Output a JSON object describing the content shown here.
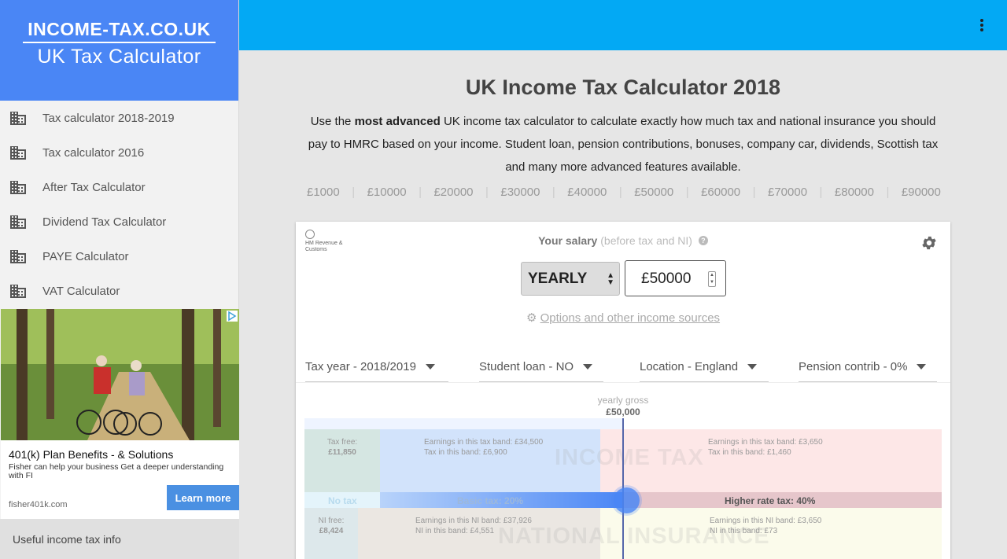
{
  "brand": {
    "site": "INCOME-TAX.CO.UK",
    "subtitle": "UK Tax Calculator"
  },
  "sidebar": {
    "items": [
      {
        "label": "Tax calculator 2018-2019",
        "icon": "building-icon"
      },
      {
        "label": "Tax calculator 2016",
        "icon": "building-icon"
      },
      {
        "label": "After Tax Calculator",
        "icon": "building-icon"
      },
      {
        "label": "Dividend Tax Calculator",
        "icon": "building-icon"
      },
      {
        "label": "PAYE Calculator",
        "icon": "building-icon"
      },
      {
        "label": "VAT Calculator",
        "icon": "building-icon"
      }
    ],
    "footer_link": "Useful income tax info"
  },
  "ad": {
    "title": "401(k) Plan Benefits - & Solutions",
    "description": "Fisher can help your business Get a deeper understanding with FI",
    "domain": "fisher401k.com",
    "cta": "Learn more"
  },
  "main": {
    "title": "UK Income Tax Calculator 2018",
    "intro_pre": "Use the ",
    "intro_bold": "most advanced",
    "intro_post": " UK income tax calculator to calculate exactly how much tax and national insurance you should pay to HMRC based on your income. Student loan, pension contributions, bonuses, company car, dividends, Scottish tax and many more advanced features available.",
    "quick_amounts": [
      "£1000",
      "£10000",
      "£20000",
      "£30000",
      "£40000",
      "£50000",
      "£60000",
      "£70000",
      "£80000",
      "£90000"
    ]
  },
  "calculator": {
    "hmrc_logo_text": "HM Revenue & Customs",
    "salary_label": "Your salary",
    "salary_label_muted": "(before tax and NI)",
    "help_glyph": "?",
    "period": "YEARLY",
    "amount": "£50000",
    "options_link": "Options and other income sources",
    "filters": {
      "tax_year": "Tax year - 2018/2019",
      "student_loan": "Student loan - NO",
      "location": "Location - England",
      "pension": "Pension contrib - 0%"
    },
    "gross_caption": "yearly gross",
    "gross_value": "£50,000",
    "tax": {
      "watermark": "INCOME TAX",
      "free_label": "Tax free:",
      "free_value": "£11,850",
      "basic_earnings": "Earnings in this tax band: £34,500",
      "basic_tax": "Tax in this band: £6,900",
      "higher_earnings": "Earnings in this tax band: £3,650",
      "higher_tax": "Tax in this band: £1,460",
      "no_tax_label": "No tax",
      "basic_label": "Basic tax: 20%",
      "higher_label": "Higher rate tax: 40%"
    },
    "ni": {
      "watermark": "NATIONAL INSURANCE",
      "free_label": "NI free:",
      "free_value": "£8,424",
      "band1_earnings": "Earnings in this NI band: £37,926",
      "band1_ni": "NI in this band: £4,551",
      "band2_earnings": "Earnings in this NI band: £3,650",
      "band2_ni": "NI in this band: £73"
    },
    "slider_fraction": 0.5
  },
  "colors": {
    "topbar": "#03a9f4",
    "brand": "#4a86f5",
    "cta": "#4a90e2"
  }
}
